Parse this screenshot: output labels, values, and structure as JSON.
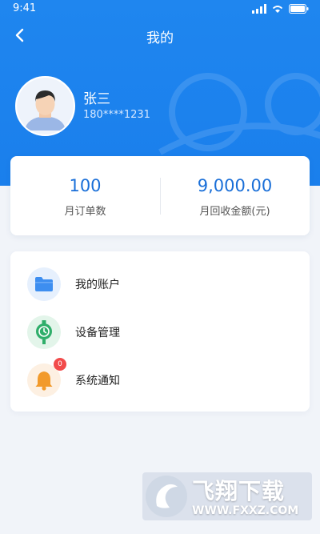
{
  "status_bar": {
    "time": "9:41"
  },
  "nav": {
    "title": "我的",
    "back_icon": "chevron-left-icon"
  },
  "user": {
    "name": "张三",
    "phone": "180****1231",
    "avatar_icon": "user-avatar-icon"
  },
  "stats": [
    {
      "value": "100",
      "label": "月订单数"
    },
    {
      "value": "9,000.00",
      "label": "月回收金额(元)"
    }
  ],
  "menu": [
    {
      "label": "我的账户",
      "icon": "folder-icon",
      "color": "#3d8ef0"
    },
    {
      "label": "设备管理",
      "icon": "device-icon",
      "color": "#2fae6a"
    },
    {
      "label": "系统通知",
      "icon": "bell-icon",
      "color": "#f29a2b",
      "badge": "0"
    }
  ],
  "watermark": {
    "title": "飞翔下载",
    "url": "WWW.FXXZ.COM"
  },
  "colors": {
    "primary": "#1f86ef",
    "accent_text": "#1a6fd8",
    "badge": "#f24b4b"
  }
}
